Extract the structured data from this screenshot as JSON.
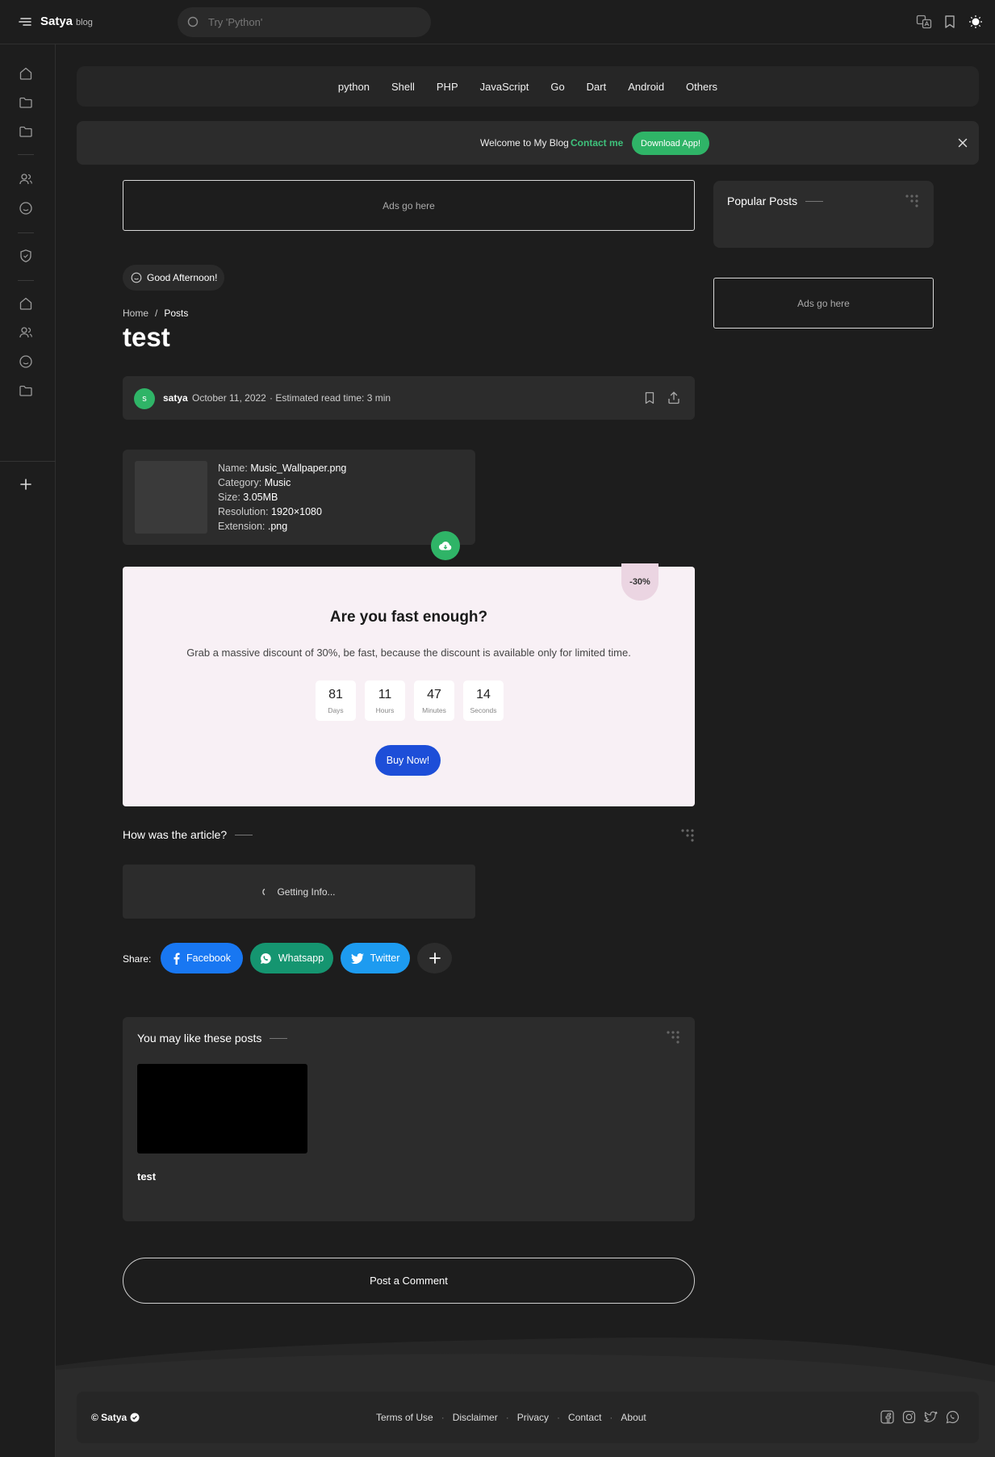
{
  "header": {
    "brand_name": "Satya",
    "brand_sub": "blog",
    "search_placeholder": "Try 'Python'",
    "actions": [
      "translate-icon",
      "bookmark-icon",
      "theme-toggle-icon"
    ]
  },
  "sidebar": {
    "icons": [
      "home-icon",
      "folder-icon",
      "folder-icon",
      "users-icon",
      "smile-icon",
      "shield-icon",
      "home-icon",
      "users-icon",
      "smile-icon",
      "folder-icon",
      "plus-icon"
    ]
  },
  "nav": {
    "items": [
      "python",
      "Shell",
      "PHP",
      "JavaScript",
      "Go",
      "Dart",
      "Android",
      "Others"
    ]
  },
  "notice": {
    "message": "Welcome to My Blog",
    "contact_label": "Contact me",
    "download_label": "Download App!"
  },
  "ads": {
    "main": "Ads go here",
    "side": "Ads go here"
  },
  "popular": {
    "title": "Popular Posts"
  },
  "post": {
    "greeting": "Good Afternoon!",
    "breadcrumb": [
      "Home",
      "Posts"
    ],
    "title": "test",
    "author_initial": "s",
    "author": "satya",
    "date": "October 11, 2022",
    "read_time": "· Estimated read time: 3 min"
  },
  "file": {
    "name_label": "Name:",
    "name": "Music_Wallpaper.png",
    "category_label": "Category:",
    "category": "Music",
    "size_label": "Size:",
    "size": "3.05MB",
    "resolution_label": "Resolution:",
    "resolution": "1920×1080",
    "extension_label": "Extension:",
    "extension": ".png"
  },
  "promo": {
    "badge": "-30%",
    "heading": "Are you fast enough?",
    "text": "Grab a massive discount of 30%, be fast, because the discount is available only for limited time.",
    "countdown": [
      {
        "value": "81",
        "label": "Days"
      },
      {
        "value": "11",
        "label": "Hours"
      },
      {
        "value": "47",
        "label": "Minutes"
      },
      {
        "value": "14",
        "label": "Seconds"
      }
    ],
    "button": "Buy Now!"
  },
  "feedback": {
    "title": "How was the article?",
    "status": "Getting Info..."
  },
  "share": {
    "label": "Share:",
    "facebook": "Facebook",
    "whatsapp": "Whatsapp",
    "twitter": "Twitter"
  },
  "related": {
    "title": "You may like these posts",
    "post_title": "test"
  },
  "comment": {
    "label": "Post a Comment"
  },
  "footer": {
    "copyright": "© Satya",
    "links": [
      "Terms of Use",
      "Disclaimer",
      "Privacy",
      "Contact",
      "About"
    ],
    "social": [
      "facebook-icon",
      "instagram-icon",
      "twitter-icon",
      "whatsapp-icon"
    ]
  },
  "colors": {
    "background": "#1d1d1d",
    "card": "#2c2c2c",
    "accent_green": "#2fb467",
    "promo_bg": "#f8f0f5",
    "buy_blue": "#1d4ed8",
    "facebook": "#1877f2",
    "whatsapp": "#159570",
    "twitter": "#1d9bf0"
  }
}
